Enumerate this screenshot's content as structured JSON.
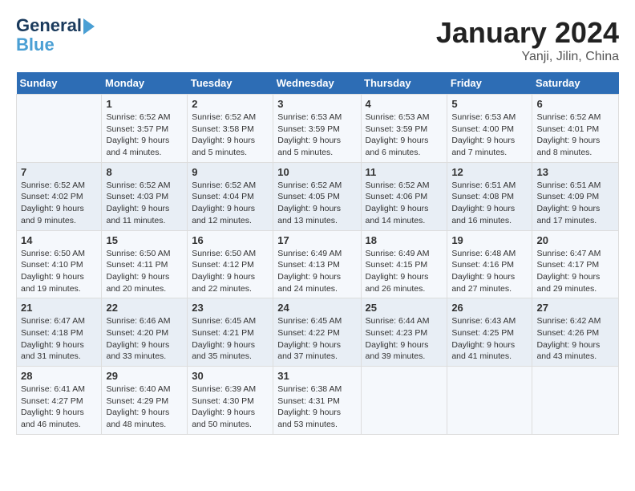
{
  "header": {
    "logo_line1": "General",
    "logo_line2": "Blue",
    "title": "January 2024",
    "subtitle": "Yanji, Jilin, China"
  },
  "days_of_week": [
    "Sunday",
    "Monday",
    "Tuesday",
    "Wednesday",
    "Thursday",
    "Friday",
    "Saturday"
  ],
  "weeks": [
    [
      {
        "num": "",
        "sunrise": "",
        "sunset": "",
        "daylight": ""
      },
      {
        "num": "1",
        "sunrise": "Sunrise: 6:52 AM",
        "sunset": "Sunset: 3:57 PM",
        "daylight": "Daylight: 9 hours and 4 minutes."
      },
      {
        "num": "2",
        "sunrise": "Sunrise: 6:52 AM",
        "sunset": "Sunset: 3:58 PM",
        "daylight": "Daylight: 9 hours and 5 minutes."
      },
      {
        "num": "3",
        "sunrise": "Sunrise: 6:53 AM",
        "sunset": "Sunset: 3:59 PM",
        "daylight": "Daylight: 9 hours and 5 minutes."
      },
      {
        "num": "4",
        "sunrise": "Sunrise: 6:53 AM",
        "sunset": "Sunset: 3:59 PM",
        "daylight": "Daylight: 9 hours and 6 minutes."
      },
      {
        "num": "5",
        "sunrise": "Sunrise: 6:53 AM",
        "sunset": "Sunset: 4:00 PM",
        "daylight": "Daylight: 9 hours and 7 minutes."
      },
      {
        "num": "6",
        "sunrise": "Sunrise: 6:52 AM",
        "sunset": "Sunset: 4:01 PM",
        "daylight": "Daylight: 9 hours and 8 minutes."
      }
    ],
    [
      {
        "num": "7",
        "sunrise": "Sunrise: 6:52 AM",
        "sunset": "Sunset: 4:02 PM",
        "daylight": "Daylight: 9 hours and 9 minutes."
      },
      {
        "num": "8",
        "sunrise": "Sunrise: 6:52 AM",
        "sunset": "Sunset: 4:03 PM",
        "daylight": "Daylight: 9 hours and 11 minutes."
      },
      {
        "num": "9",
        "sunrise": "Sunrise: 6:52 AM",
        "sunset": "Sunset: 4:04 PM",
        "daylight": "Daylight: 9 hours and 12 minutes."
      },
      {
        "num": "10",
        "sunrise": "Sunrise: 6:52 AM",
        "sunset": "Sunset: 4:05 PM",
        "daylight": "Daylight: 9 hours and 13 minutes."
      },
      {
        "num": "11",
        "sunrise": "Sunrise: 6:52 AM",
        "sunset": "Sunset: 4:06 PM",
        "daylight": "Daylight: 9 hours and 14 minutes."
      },
      {
        "num": "12",
        "sunrise": "Sunrise: 6:51 AM",
        "sunset": "Sunset: 4:08 PM",
        "daylight": "Daylight: 9 hours and 16 minutes."
      },
      {
        "num": "13",
        "sunrise": "Sunrise: 6:51 AM",
        "sunset": "Sunset: 4:09 PM",
        "daylight": "Daylight: 9 hours and 17 minutes."
      }
    ],
    [
      {
        "num": "14",
        "sunrise": "Sunrise: 6:50 AM",
        "sunset": "Sunset: 4:10 PM",
        "daylight": "Daylight: 9 hours and 19 minutes."
      },
      {
        "num": "15",
        "sunrise": "Sunrise: 6:50 AM",
        "sunset": "Sunset: 4:11 PM",
        "daylight": "Daylight: 9 hours and 20 minutes."
      },
      {
        "num": "16",
        "sunrise": "Sunrise: 6:50 AM",
        "sunset": "Sunset: 4:12 PM",
        "daylight": "Daylight: 9 hours and 22 minutes."
      },
      {
        "num": "17",
        "sunrise": "Sunrise: 6:49 AM",
        "sunset": "Sunset: 4:13 PM",
        "daylight": "Daylight: 9 hours and 24 minutes."
      },
      {
        "num": "18",
        "sunrise": "Sunrise: 6:49 AM",
        "sunset": "Sunset: 4:15 PM",
        "daylight": "Daylight: 9 hours and 26 minutes."
      },
      {
        "num": "19",
        "sunrise": "Sunrise: 6:48 AM",
        "sunset": "Sunset: 4:16 PM",
        "daylight": "Daylight: 9 hours and 27 minutes."
      },
      {
        "num": "20",
        "sunrise": "Sunrise: 6:47 AM",
        "sunset": "Sunset: 4:17 PM",
        "daylight": "Daylight: 9 hours and 29 minutes."
      }
    ],
    [
      {
        "num": "21",
        "sunrise": "Sunrise: 6:47 AM",
        "sunset": "Sunset: 4:18 PM",
        "daylight": "Daylight: 9 hours and 31 minutes."
      },
      {
        "num": "22",
        "sunrise": "Sunrise: 6:46 AM",
        "sunset": "Sunset: 4:20 PM",
        "daylight": "Daylight: 9 hours and 33 minutes."
      },
      {
        "num": "23",
        "sunrise": "Sunrise: 6:45 AM",
        "sunset": "Sunset: 4:21 PM",
        "daylight": "Daylight: 9 hours and 35 minutes."
      },
      {
        "num": "24",
        "sunrise": "Sunrise: 6:45 AM",
        "sunset": "Sunset: 4:22 PM",
        "daylight": "Daylight: 9 hours and 37 minutes."
      },
      {
        "num": "25",
        "sunrise": "Sunrise: 6:44 AM",
        "sunset": "Sunset: 4:23 PM",
        "daylight": "Daylight: 9 hours and 39 minutes."
      },
      {
        "num": "26",
        "sunrise": "Sunrise: 6:43 AM",
        "sunset": "Sunset: 4:25 PM",
        "daylight": "Daylight: 9 hours and 41 minutes."
      },
      {
        "num": "27",
        "sunrise": "Sunrise: 6:42 AM",
        "sunset": "Sunset: 4:26 PM",
        "daylight": "Daylight: 9 hours and 43 minutes."
      }
    ],
    [
      {
        "num": "28",
        "sunrise": "Sunrise: 6:41 AM",
        "sunset": "Sunset: 4:27 PM",
        "daylight": "Daylight: 9 hours and 46 minutes."
      },
      {
        "num": "29",
        "sunrise": "Sunrise: 6:40 AM",
        "sunset": "Sunset: 4:29 PM",
        "daylight": "Daylight: 9 hours and 48 minutes."
      },
      {
        "num": "30",
        "sunrise": "Sunrise: 6:39 AM",
        "sunset": "Sunset: 4:30 PM",
        "daylight": "Daylight: 9 hours and 50 minutes."
      },
      {
        "num": "31",
        "sunrise": "Sunrise: 6:38 AM",
        "sunset": "Sunset: 4:31 PM",
        "daylight": "Daylight: 9 hours and 53 minutes."
      },
      {
        "num": "",
        "sunrise": "",
        "sunset": "",
        "daylight": ""
      },
      {
        "num": "",
        "sunrise": "",
        "sunset": "",
        "daylight": ""
      },
      {
        "num": "",
        "sunrise": "",
        "sunset": "",
        "daylight": ""
      }
    ]
  ]
}
